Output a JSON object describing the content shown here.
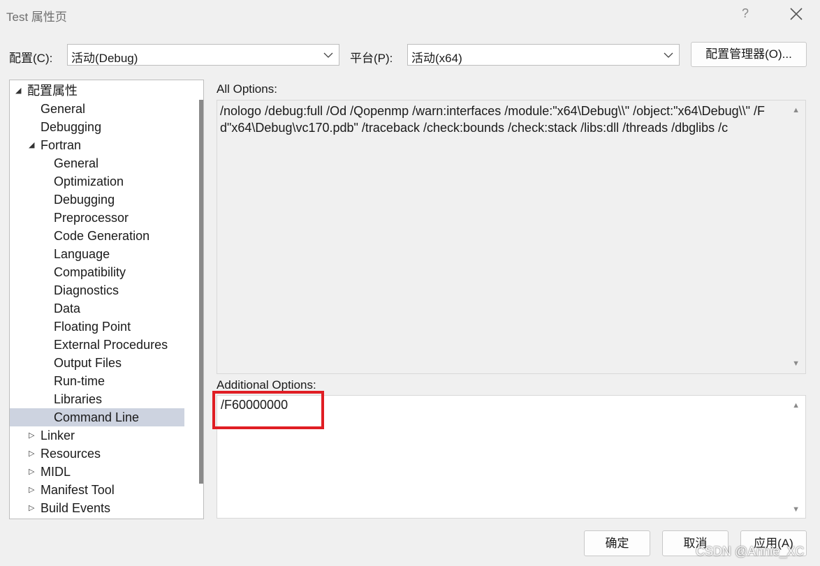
{
  "window": {
    "title": "Test 属性页",
    "help_glyph": "?"
  },
  "config": {
    "label": "配置(C):",
    "value": "活动(Debug)"
  },
  "platform": {
    "label": "平台(P):",
    "value": "活动(x64)"
  },
  "config_manager_label": "配置管理器(O)...",
  "tree": {
    "items": [
      {
        "label": "配置属性",
        "level": 0,
        "expander": "expanded"
      },
      {
        "label": "General",
        "level": 1,
        "expander": "none"
      },
      {
        "label": "Debugging",
        "level": 1,
        "expander": "none"
      },
      {
        "label": "Fortran",
        "level": 1,
        "expander": "expanded"
      },
      {
        "label": "General",
        "level": 2,
        "expander": "none"
      },
      {
        "label": "Optimization",
        "level": 2,
        "expander": "none"
      },
      {
        "label": "Debugging",
        "level": 2,
        "expander": "none"
      },
      {
        "label": "Preprocessor",
        "level": 2,
        "expander": "none"
      },
      {
        "label": "Code Generation",
        "level": 2,
        "expander": "none"
      },
      {
        "label": "Language",
        "level": 2,
        "expander": "none"
      },
      {
        "label": "Compatibility",
        "level": 2,
        "expander": "none"
      },
      {
        "label": "Diagnostics",
        "level": 2,
        "expander": "none"
      },
      {
        "label": "Data",
        "level": 2,
        "expander": "none"
      },
      {
        "label": "Floating Point",
        "level": 2,
        "expander": "none"
      },
      {
        "label": "External Procedures",
        "level": 2,
        "expander": "none"
      },
      {
        "label": "Output Files",
        "level": 2,
        "expander": "none"
      },
      {
        "label": "Run-time",
        "level": 2,
        "expander": "none"
      },
      {
        "label": "Libraries",
        "level": 2,
        "expander": "none"
      },
      {
        "label": "Command Line",
        "level": 2,
        "expander": "none",
        "selected": true
      },
      {
        "label": "Linker",
        "level": 1,
        "expander": "collapsed"
      },
      {
        "label": "Resources",
        "level": 1,
        "expander": "collapsed"
      },
      {
        "label": "MIDL",
        "level": 1,
        "expander": "collapsed"
      },
      {
        "label": "Manifest Tool",
        "level": 1,
        "expander": "collapsed"
      },
      {
        "label": "Build Events",
        "level": 1,
        "expander": "collapsed"
      }
    ]
  },
  "all_options": {
    "label": "All Options:",
    "text": "/nologo /debug:full /Od /Qopenmp /warn:interfaces /module:\"x64\\Debug\\\\\" /object:\"x64\\Debug\\\\\" /Fd\"x64\\Debug\\vc170.pdb\" /traceback /check:bounds /check:stack /libs:dll /threads /dbglibs /c"
  },
  "additional_options": {
    "label": "Additional Options:",
    "value": "/F60000000"
  },
  "buttons": {
    "ok": "确定",
    "cancel": "取消",
    "apply": "应用(A)"
  },
  "watermark": "CSDN @Annie_XC",
  "colors": {
    "selection": "#cdd3e0",
    "highlight_box": "#e01e24",
    "background": "#f0f0f0"
  }
}
